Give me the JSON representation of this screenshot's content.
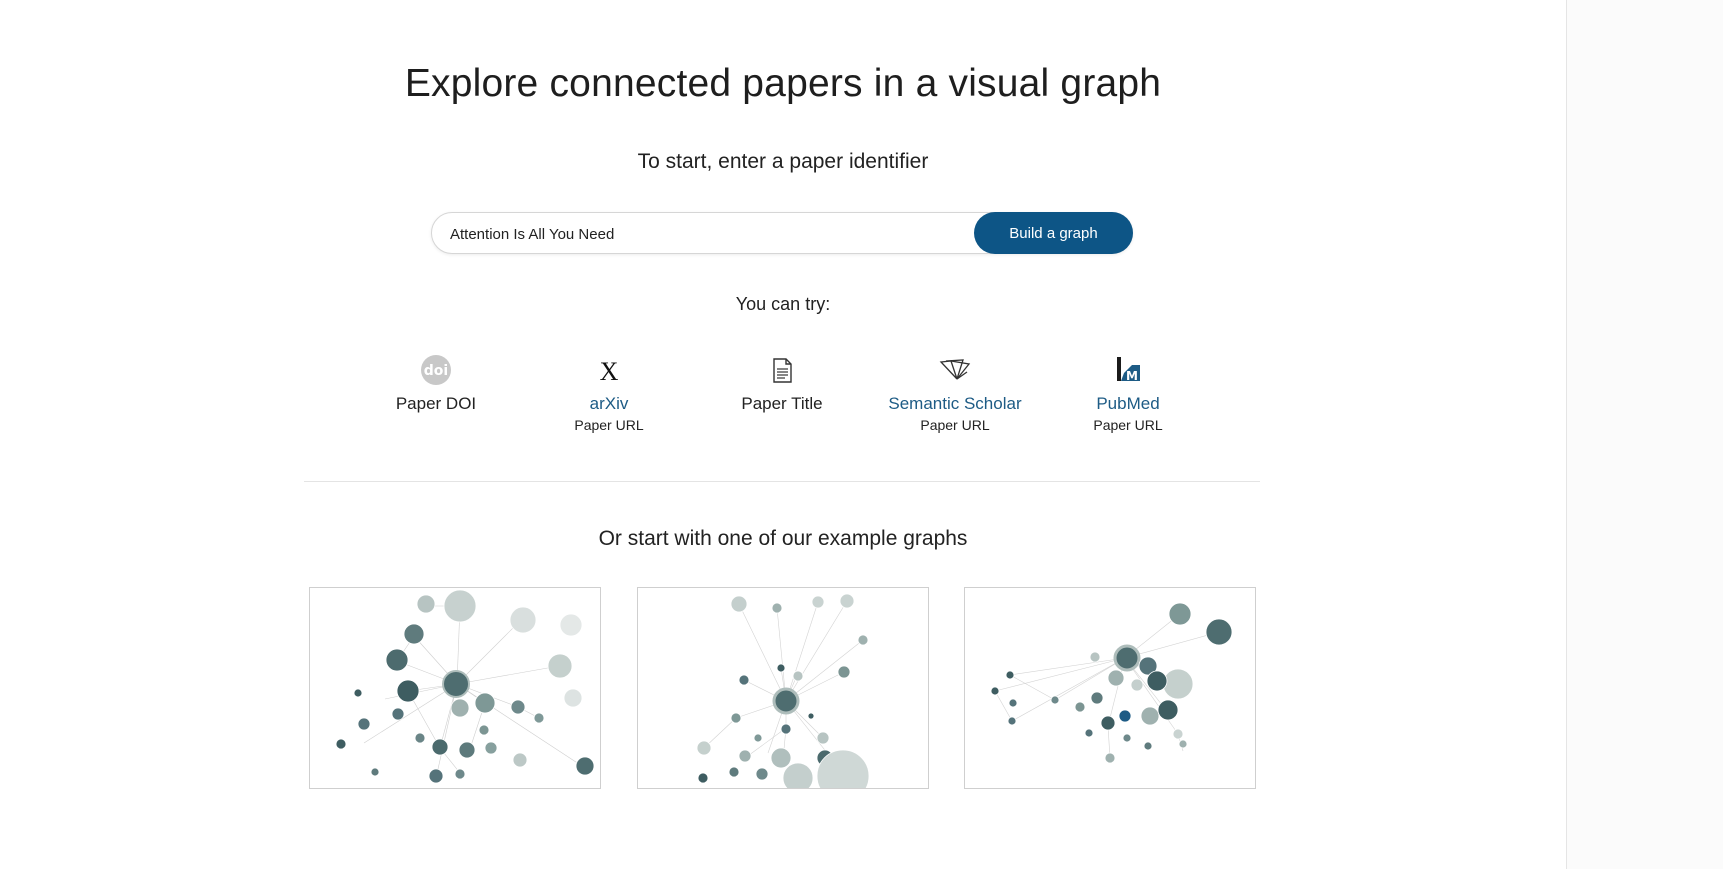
{
  "page": {
    "title": "Explore connected papers in a visual graph",
    "subtitle": "To start, enter a paper identifier"
  },
  "search": {
    "value": "Attention Is All You Need",
    "button_label": "Build a graph"
  },
  "try": {
    "label": "You can try:",
    "options": [
      {
        "icon": "doi-icon",
        "label": "Paper DOI",
        "sublabel": ""
      },
      {
        "icon": "arxiv-icon",
        "label": "arXiv",
        "sublabel": "Paper URL"
      },
      {
        "icon": "document-icon",
        "label": "Paper Title",
        "sublabel": ""
      },
      {
        "icon": "semantic-scholar-icon",
        "label": "Semantic Scholar",
        "sublabel": "Paper URL"
      },
      {
        "icon": "pubmed-icon",
        "label": "PubMed",
        "sublabel": "Paper URL"
      }
    ]
  },
  "examples": {
    "title": "Or start with one of our example graphs"
  },
  "colors": {
    "accent": "#0d5586",
    "link": "#1d5b85",
    "node_dark": "#3f5f63",
    "node_light": "#c9d3d1"
  }
}
